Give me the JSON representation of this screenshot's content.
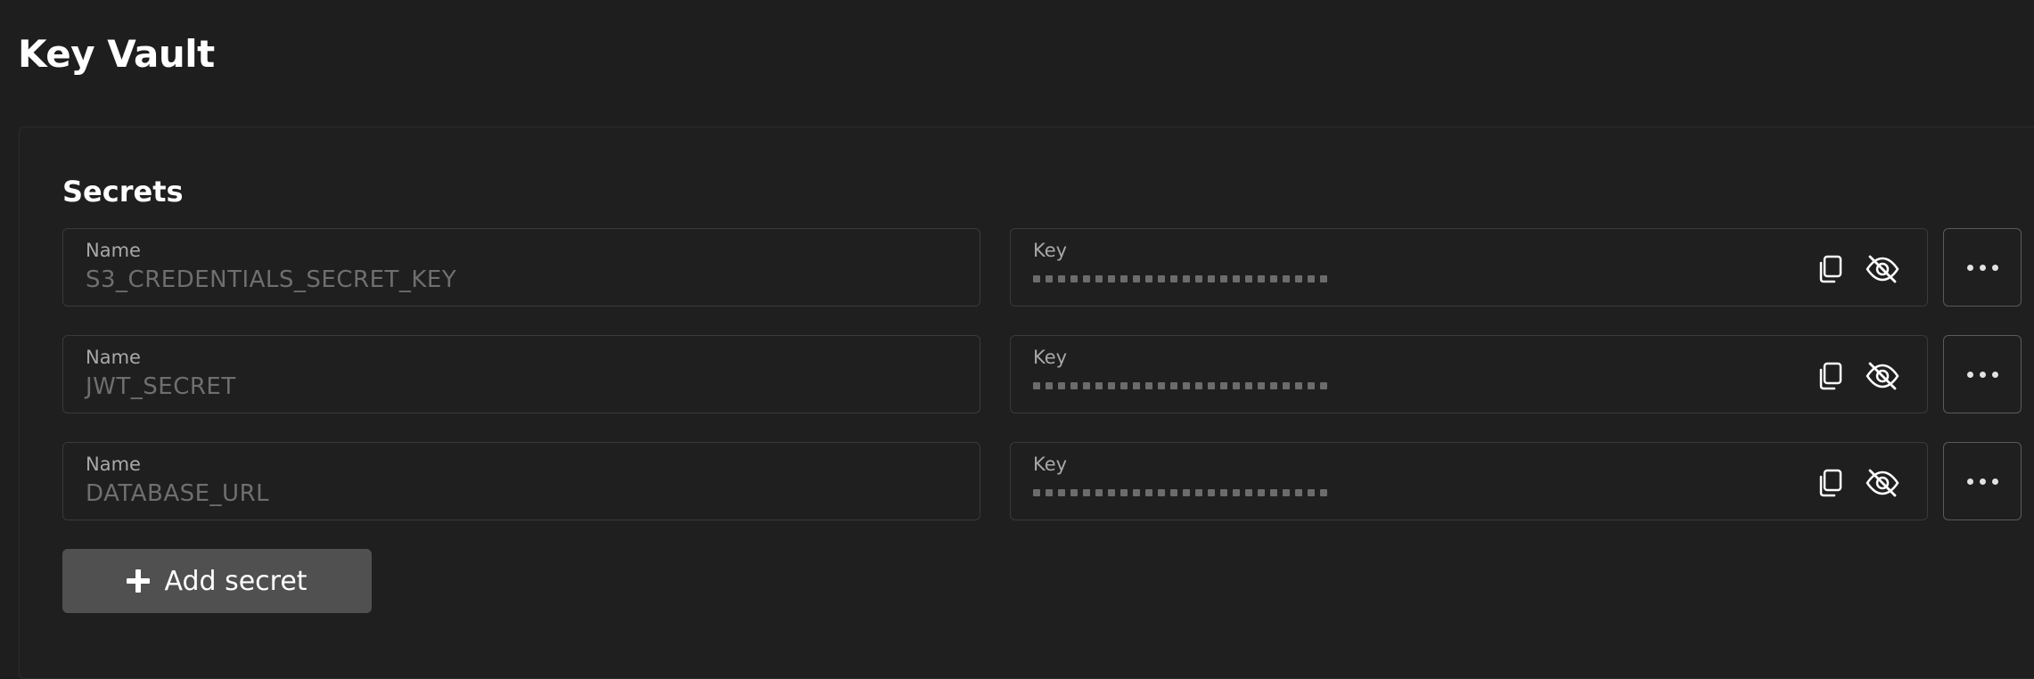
{
  "page": {
    "title": "Key Vault"
  },
  "secrets_section": {
    "title": "Secrets",
    "add_button_label": "Add secret",
    "items": [
      {
        "name_label": "Name",
        "name_value": "S3_CREDENTIALS_SECRET_KEY",
        "key_label": "Key"
      },
      {
        "name_label": "Name",
        "name_value": "JWT_SECRET",
        "key_label": "Key"
      },
      {
        "name_label": "Name",
        "name_value": "DATABASE_URL",
        "key_label": "Key"
      }
    ]
  },
  "icons": {
    "copy": "copy-icon",
    "hidden": "eye-off-icon",
    "more": "more-horizontal-icon",
    "add": "plus-icon"
  },
  "colors": {
    "background": "#1e1e1e",
    "field_border": "#3a3a3a",
    "button": "#505050",
    "muted_text": "#6f6f6f"
  }
}
